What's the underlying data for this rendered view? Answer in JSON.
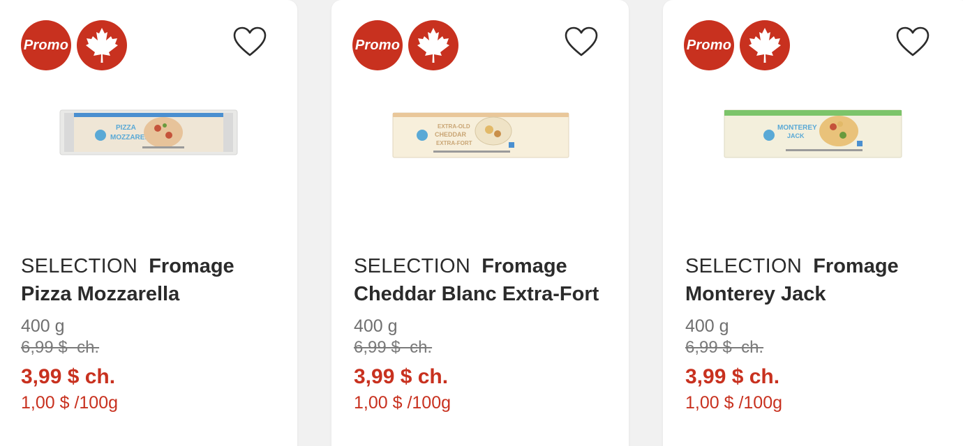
{
  "products": [
    {
      "promo_label": "Promo",
      "brand": "SELECTION",
      "name": "Fromage Pizza Mozzarella",
      "size": "400 g",
      "old_price": "6,99 $  ch.",
      "sale_price": "3,99 $ ch.",
      "unit_price": "1,00 $ /100g",
      "package_text": [
        "PIZZA",
        "MOZZARELLA"
      ],
      "package_accent": "#5aa9d6"
    },
    {
      "promo_label": "Promo",
      "brand": "SELECTION",
      "name": "Fromage Cheddar Blanc Extra-Fort",
      "size": "400 g",
      "old_price": "6,99 $  ch.",
      "sale_price": "3,99 $ ch.",
      "unit_price": "1,00 $ /100g",
      "package_text": [
        "EXTRA-OLD",
        "CHEDDAR",
        "EXTRA-FORT"
      ],
      "package_accent": "#e9c79a"
    },
    {
      "promo_label": "Promo",
      "brand": "SELECTION",
      "name": "Fromage Monterey Jack",
      "size": "400 g",
      "old_price": "6,99 $  ch.",
      "sale_price": "3,99 $ ch.",
      "unit_price": "1,00 $ /100g",
      "package_text": [
        "MONTEREY",
        "JACK"
      ],
      "package_accent": "#7cc46a"
    }
  ],
  "icons": {
    "promo_badge": "promo-badge",
    "canada": "maple-leaf-icon",
    "favorite": "heart-outline-icon"
  },
  "colors": {
    "accent_red": "#c8311f",
    "text_dark": "#2b2b2b",
    "text_muted": "#6f6f6f",
    "background": "#f1f1f1",
    "card": "#ffffff"
  }
}
